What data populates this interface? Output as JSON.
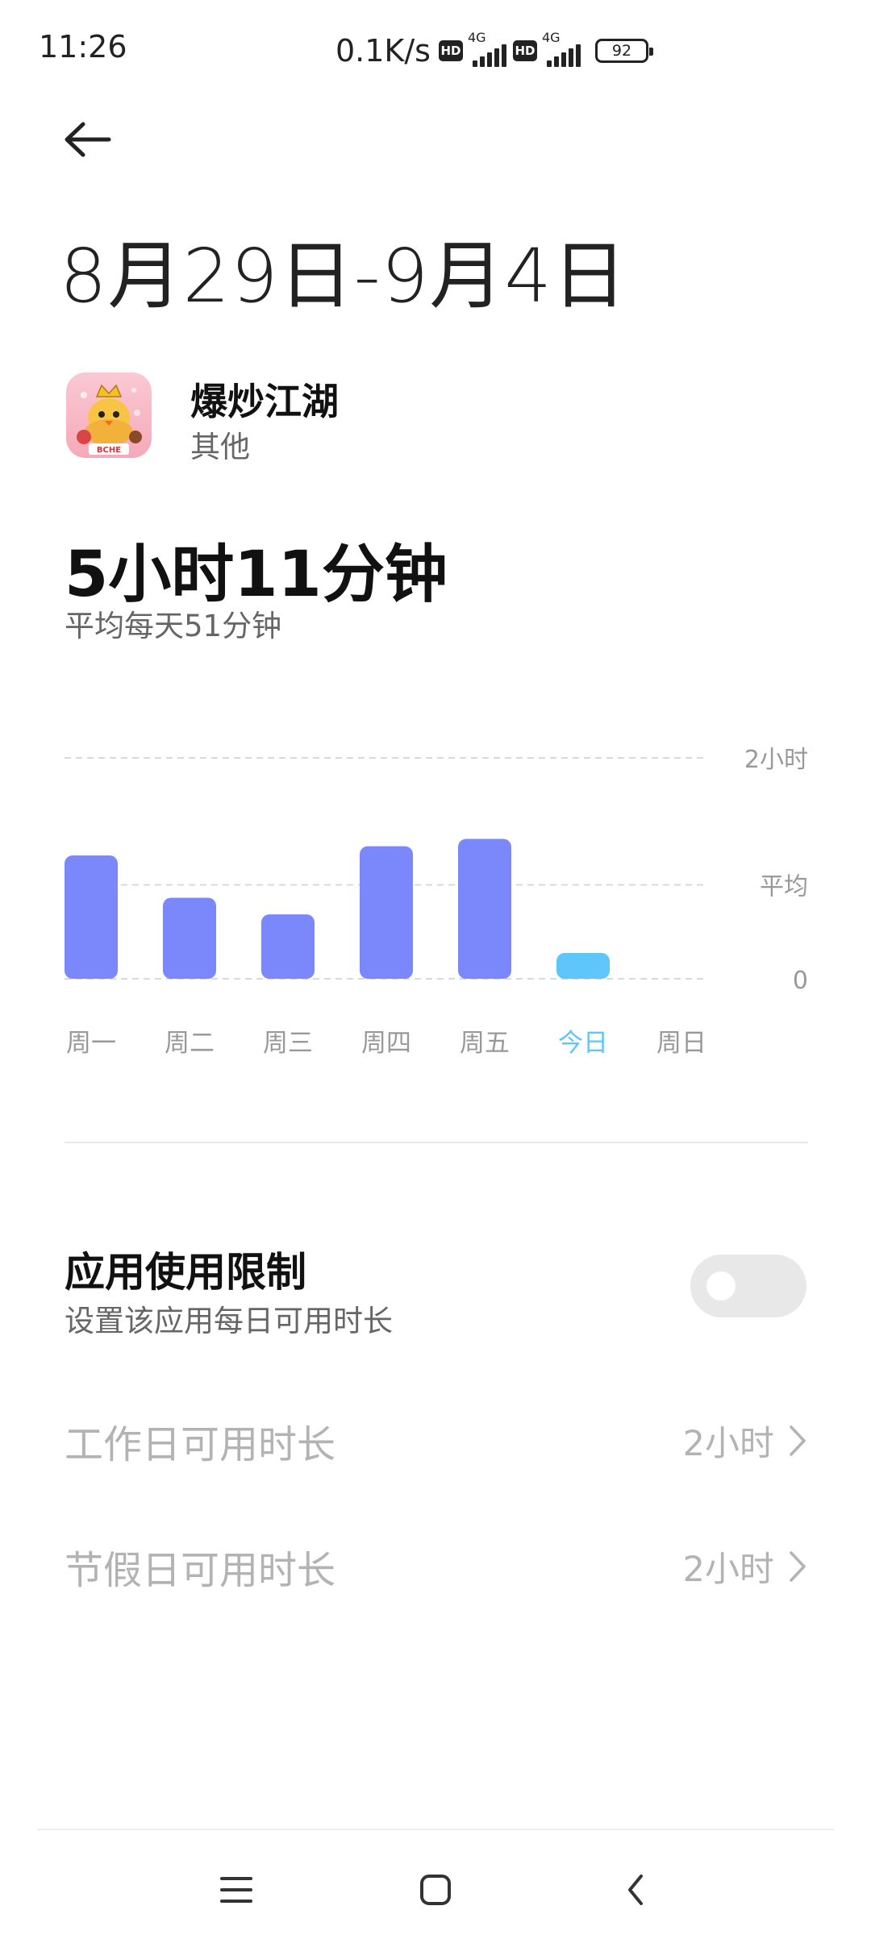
{
  "status_bar": {
    "time": "11:26",
    "net_speed": "0.1K/s",
    "hd_label": "HD",
    "network_1": "4G",
    "network_2": "4G",
    "battery": "92"
  },
  "header": {
    "back_icon": "arrow-left-icon",
    "date_range": "8月29日-9月4日"
  },
  "app": {
    "name": "爆炒江湖",
    "category": "其他",
    "icon_badge": "BCHE"
  },
  "summary": {
    "total": "5小时11分钟",
    "average": "平均每天51分钟"
  },
  "chart_data": {
    "type": "bar",
    "categories": [
      "周一",
      "周二",
      "周三",
      "周四",
      "周五",
      "今日",
      "周日"
    ],
    "values_minutes": [
      67,
      44,
      35,
      72,
      76,
      14,
      null
    ],
    "today_index": 5,
    "ylim_minutes": [
      0,
      120
    ],
    "reference_lines": [
      {
        "label": "2小时",
        "value_minutes": 120
      },
      {
        "label": "平均",
        "value_minutes": 51
      },
      {
        "label": "0",
        "value_minutes": 0
      }
    ],
    "colors": {
      "bar": "#7b88fb",
      "today": "#5fc6fb",
      "grid": "#d9d9d9",
      "label": "#999999"
    }
  },
  "limit": {
    "title": "应用使用限制",
    "description": "设置该应用每日可用时长",
    "toggle_on": false
  },
  "rows": [
    {
      "label": "工作日可用时长",
      "value": "2小时"
    },
    {
      "label": "节假日可用时长",
      "value": "2小时"
    }
  ],
  "nav": {
    "menu_icon": "menu-icon",
    "home_icon": "home-square-icon",
    "back_icon": "nav-back-icon"
  }
}
